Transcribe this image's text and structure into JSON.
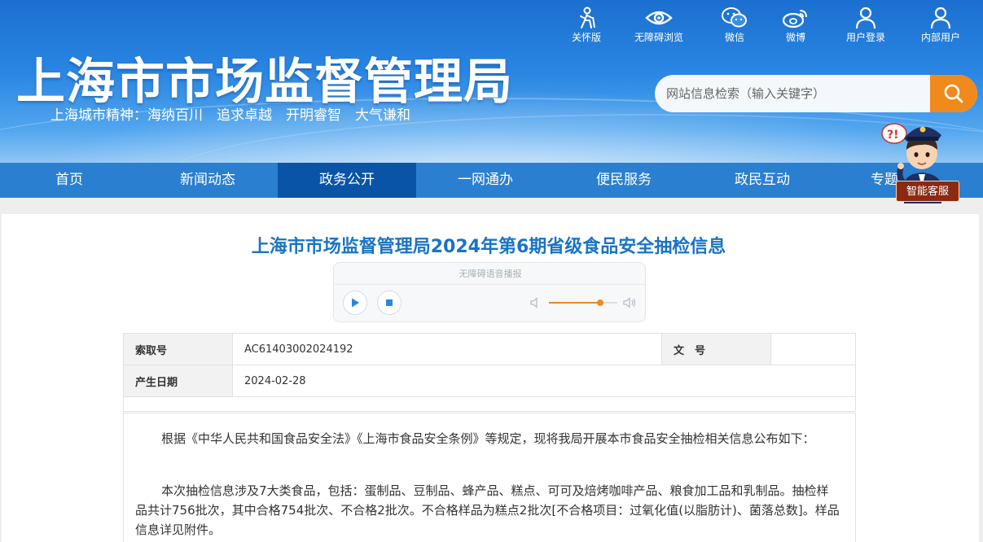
{
  "header": {
    "site_title": "上海市市场监督管理局",
    "motto": "上海城市精神：海纳百川　追求卓越　开明睿智　大气谦和",
    "toolbar": [
      {
        "label": "关怀版",
        "icon": "elderly-care-icon"
      },
      {
        "label": "无障碍浏览",
        "icon": "eye-icon"
      },
      {
        "label": "微信",
        "icon": "wechat-icon"
      },
      {
        "label": "微博",
        "icon": "weibo-icon"
      },
      {
        "label": "用户登录",
        "icon": "user-icon"
      },
      {
        "label": "内部用户",
        "icon": "user-icon"
      }
    ],
    "search": {
      "placeholder": "网站信息检索（输入关键字）",
      "button_icon": "search-icon"
    }
  },
  "nav": {
    "items": [
      "首页",
      "新闻动态",
      "政务公开",
      "一网通办",
      "便民服务",
      "政民互动",
      "专题"
    ],
    "active_index": 2
  },
  "assistant": {
    "label": "智能客服"
  },
  "article": {
    "title": "上海市市场监督管理局2024年第6期省级食品安全抽检信息",
    "player": {
      "caption": "无障碍语音播报",
      "volume_level": 0.75
    },
    "meta": {
      "index_label": "索取号",
      "index_value": "AC61403002024192",
      "doc_no_label": "文　号",
      "doc_no_value": "",
      "date_label": "产生日期",
      "date_value": "2024-02-28"
    },
    "paragraphs": [
      "根据《中华人民共和国食品安全法》《上海市食品安全条例》等规定，现将我局开展本市食品安全抽检相关信息公布如下：",
      "本次抽检信息涉及7大类食品，包括：蛋制品、豆制品、蜂产品、糕点、可可及焙烤咖啡产品、粮食加工品和乳制品。抽检样品共计756批次，其中合格754批次、不合格2批次。不合格样品为糕点2批次[不合格项目：过氧化值(以脂肪计)、菌落总数]。样品信息详见附件。"
    ]
  },
  "colors": {
    "header_blue": "#2a86e2",
    "nav_blue": "#2a7fd0",
    "nav_active": "#0a54a8",
    "title_blue": "#1a73c6",
    "accent_orange": "#f08a1c"
  }
}
